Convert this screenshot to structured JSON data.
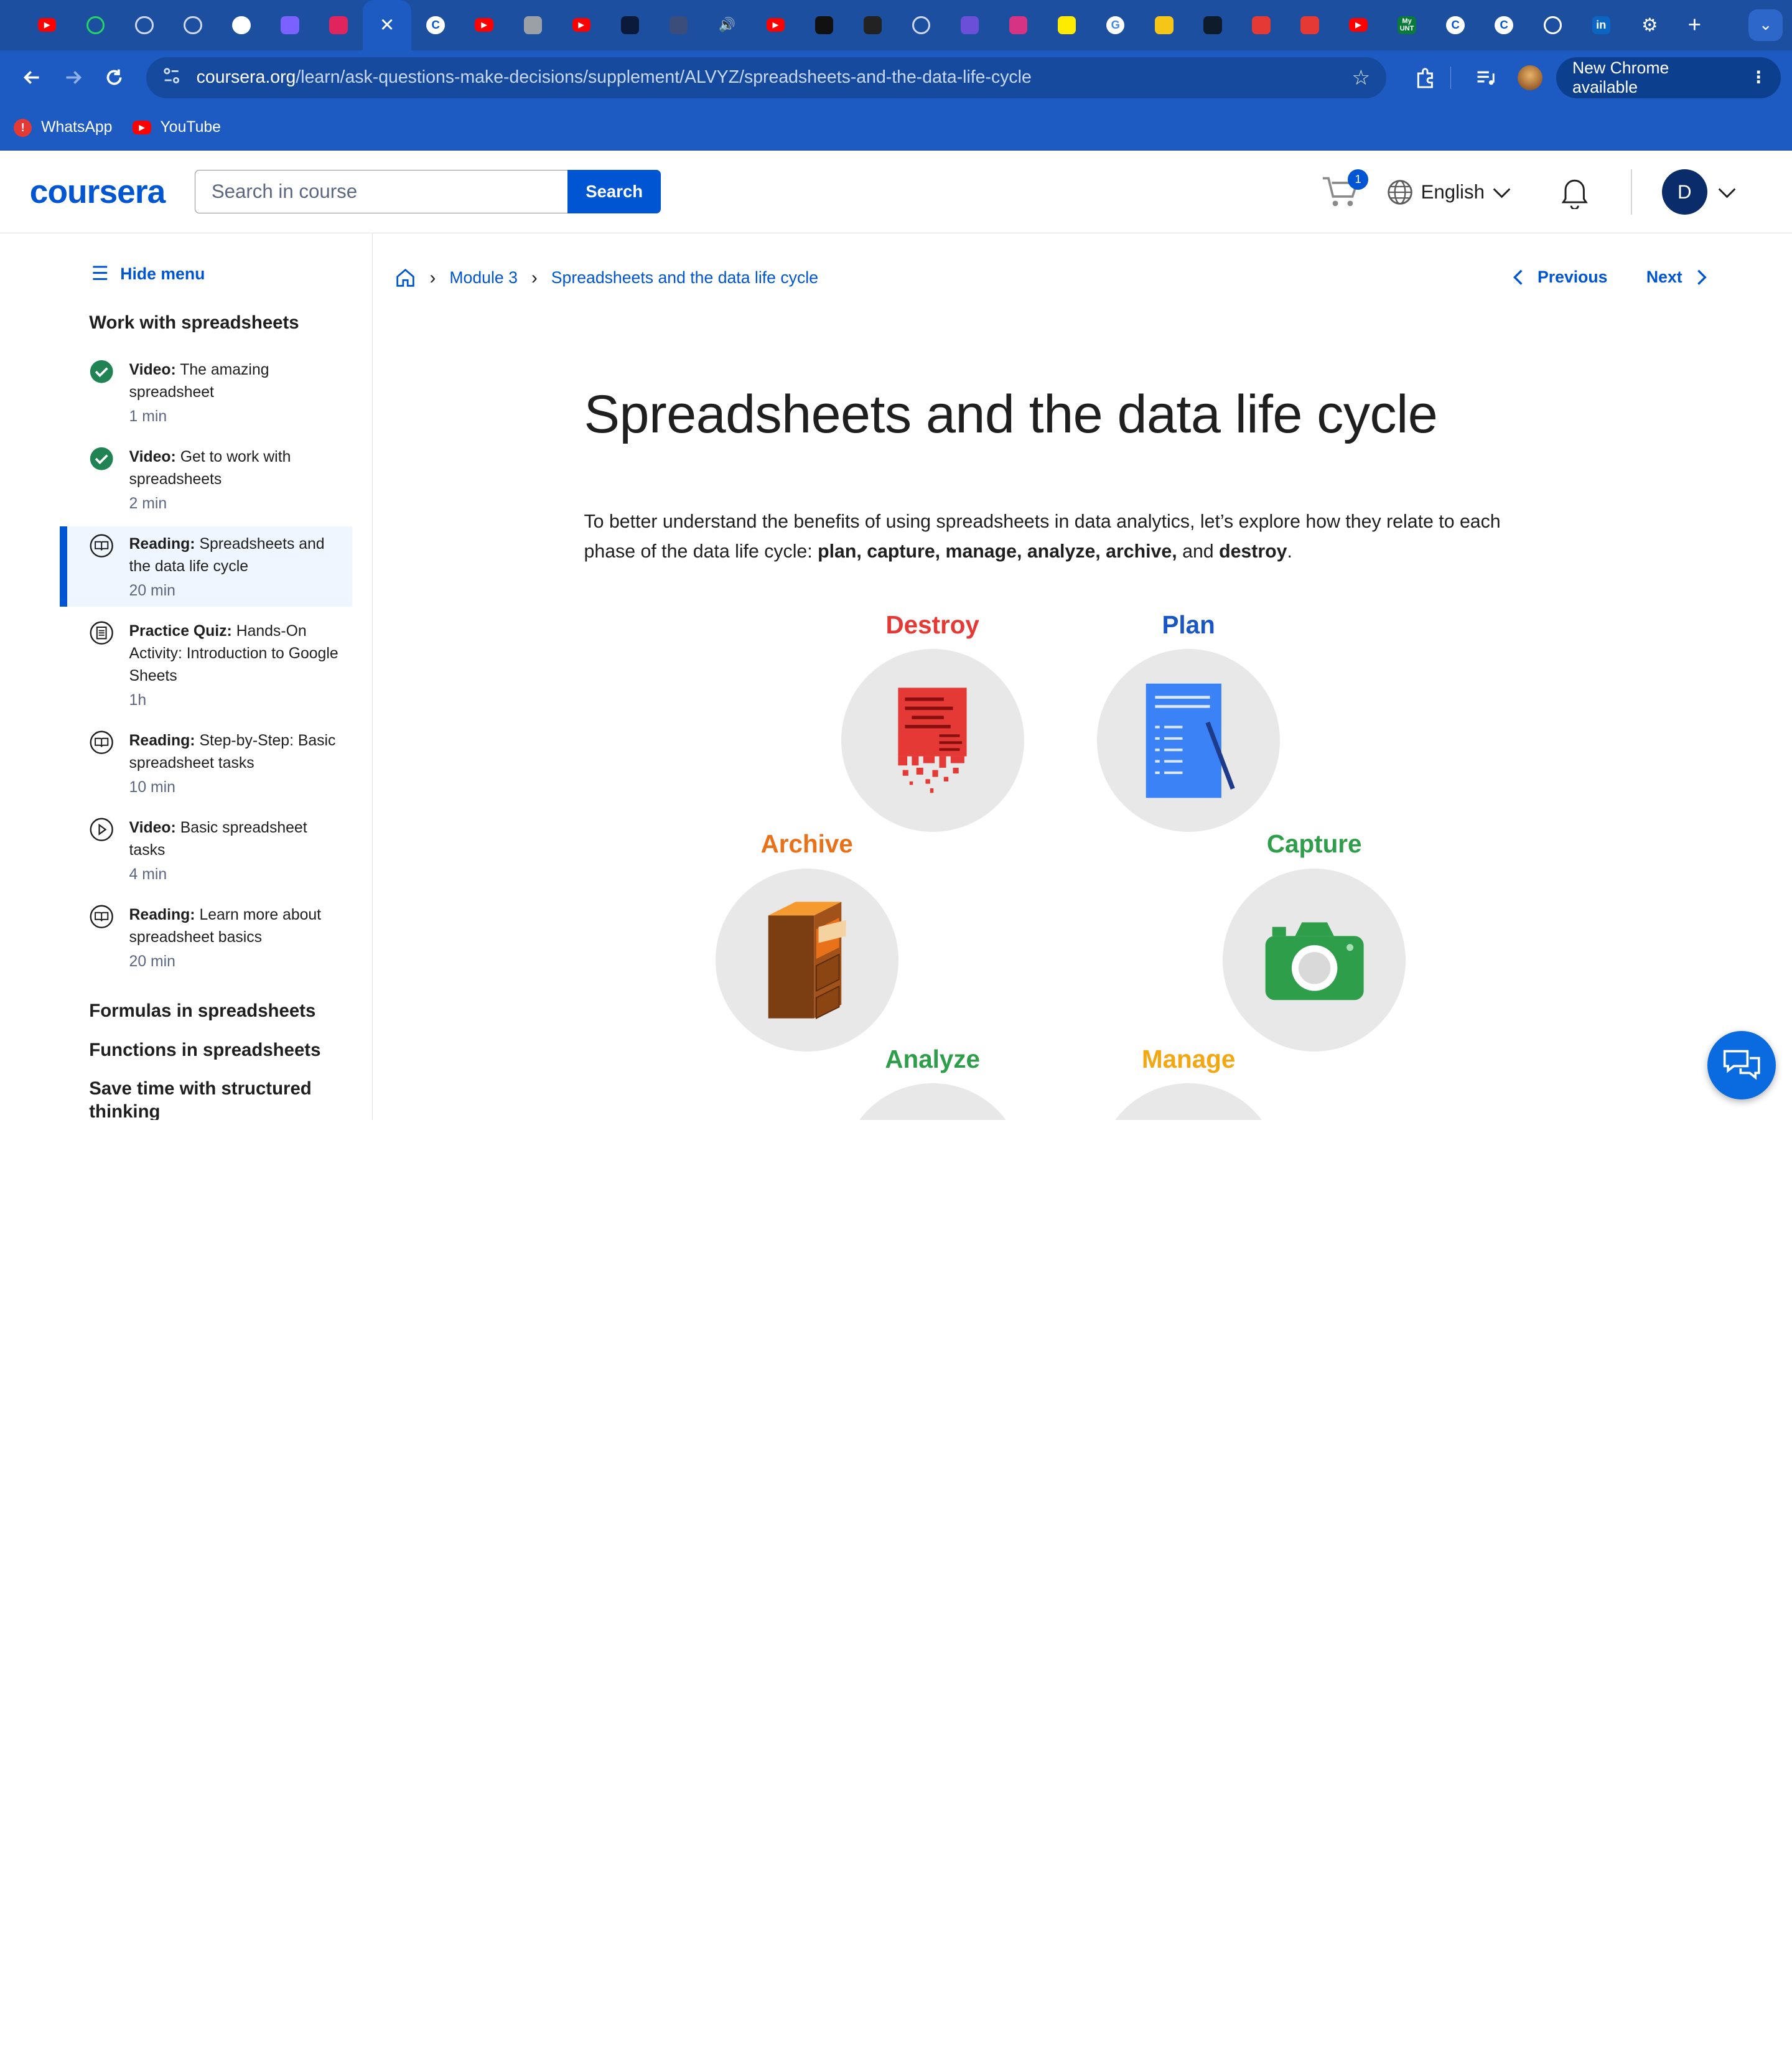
{
  "browser": {
    "tabs": [
      {
        "icon": "youtube-icon",
        "color": "#ff0000"
      },
      {
        "icon": "whatsapp-icon",
        "color": "#25d366"
      },
      {
        "icon": "loading-icon",
        "color": "#cfd8ea"
      },
      {
        "icon": "loading-icon",
        "color": "#cfd8ea"
      },
      {
        "icon": "github-icon",
        "color": "#ffffff"
      },
      {
        "icon": "app-icon",
        "color": "#7b61ff"
      },
      {
        "icon": "app-icon",
        "color": "#e0245e"
      },
      {
        "icon": "close-icon",
        "color": "#ffffff",
        "active": true
      },
      {
        "icon": "coursera-icon",
        "color": "#0056d2"
      },
      {
        "icon": "youtube-icon",
        "color": "#ff0000"
      },
      {
        "icon": "video-icon",
        "color": "#9aa0a6"
      },
      {
        "icon": "youtube-icon",
        "color": "#ff0000"
      },
      {
        "icon": "app-icon",
        "color": "#0b1a3a"
      },
      {
        "icon": "app-icon",
        "color": "#3b4d7a"
      },
      {
        "icon": "audio-icon",
        "color": "#ffffff"
      },
      {
        "icon": "youtube-icon",
        "color": "#ff0000"
      },
      {
        "icon": "app-icon",
        "color": "#111111"
      },
      {
        "icon": "app-icon",
        "color": "#222222"
      },
      {
        "icon": "loading-icon",
        "color": "#cfd8ea"
      },
      {
        "icon": "app-icon",
        "color": "#6b4fd8"
      },
      {
        "icon": "app-icon",
        "color": "#d63384"
      },
      {
        "icon": "app-icon",
        "color": "#ffeb00"
      },
      {
        "icon": "google-icon",
        "color": "#ffffff"
      },
      {
        "icon": "app-icon",
        "color": "#f5c518"
      },
      {
        "icon": "app-icon",
        "color": "#0d1b2a"
      },
      {
        "icon": "app-icon",
        "color": "#e53935"
      },
      {
        "icon": "app-icon",
        "color": "#e53935"
      },
      {
        "icon": "youtube-icon",
        "color": "#ff0000"
      },
      {
        "icon": "app-icon",
        "color": "#0a7a3b",
        "text": "My UNT"
      },
      {
        "icon": "coursera-icon",
        "color": "#0056d2"
      },
      {
        "icon": "coursera-icon",
        "color": "#0056d2"
      },
      {
        "icon": "chatgpt-icon",
        "color": "#ffffff"
      },
      {
        "icon": "linkedin-icon",
        "color": "#0a66c2"
      },
      {
        "icon": "settings-icon",
        "color": "#ffffff"
      }
    ],
    "url_host": "coursera.org",
    "url_path": "/learn/ask-questions-make-decisions/supplement/ALVYZ/spreadsheets-and-the-data-life-cycle",
    "update_label": "New Chrome available",
    "bookmarks": [
      {
        "label": "WhatsApp",
        "icon": "whatsapp-icon",
        "color": "#e53935"
      },
      {
        "label": "YouTube",
        "icon": "youtube-icon",
        "color": "#ff0000"
      }
    ]
  },
  "header": {
    "logo": "coursera",
    "search_placeholder": "Search in course",
    "search_button": "Search",
    "cart_count": "1",
    "language": "English",
    "avatar_initial": "D",
    "brand_color": "#0056d2"
  },
  "sidebar": {
    "hide_menu": "Hide menu",
    "current_section": "Work with spreadsheets",
    "items": [
      {
        "type": "Video:",
        "title": "The amazing spreadsheet",
        "duration": "1 min",
        "status": "completed-icon"
      },
      {
        "type": "Video:",
        "title": "Get to work with spreadsheets",
        "duration": "2 min",
        "status": "completed-icon"
      },
      {
        "type": "Reading:",
        "title": "Spreadsheets and the data life cycle",
        "duration": "20 min",
        "status": "reading-icon",
        "active": true
      },
      {
        "type": "Practice Quiz:",
        "title": "Hands-On Activity: Introduction to Google Sheets",
        "duration": "1h",
        "status": "quiz-icon"
      },
      {
        "type": "Reading:",
        "title": "Step-by-Step: Basic spreadsheet tasks",
        "duration": "10 min",
        "status": "reading-icon"
      },
      {
        "type": "Video:",
        "title": "Basic spreadsheet tasks",
        "duration": "4 min",
        "status": "play-icon"
      },
      {
        "type": "Reading:",
        "title": "Learn more about spreadsheet basics",
        "duration": "20 min",
        "status": "reading-icon"
      }
    ],
    "other_sections": [
      "Formulas in spreadsheets",
      "Functions in spreadsheets",
      "Save time with structured thinking"
    ]
  },
  "main": {
    "breadcrumb": [
      "Module 3",
      "Spreadsheets and the data life cycle"
    ],
    "previous": "Previous",
    "next": "Next",
    "title": "Spreadsheets and the data life cycle",
    "intro_lead": "To better understand the benefits of using spreadsheets in data analytics, let’s explore how they relate to each phase of the data life cycle: ",
    "intro_phases": "plan, capture, manage, analyze, archive,",
    "intro_and": " and ",
    "intro_last": "destroy",
    "intro_end": ".",
    "cycle": [
      {
        "label": "Destroy",
        "color": "#e53935",
        "icon": "shredded-document-icon"
      },
      {
        "label": "Plan",
        "color": "#1a56c4",
        "icon": "document-pencil-icon"
      },
      {
        "label": "Archive",
        "color": "#e8711a",
        "icon": "filing-cabinet-icon"
      },
      {
        "label": "Capture",
        "color": "#2e9e4a",
        "icon": "camera-icon"
      },
      {
        "label": "Analyze",
        "color": "#2e9e4a"
      },
      {
        "label": "Manage",
        "color": "#f3a712"
      }
    ]
  }
}
